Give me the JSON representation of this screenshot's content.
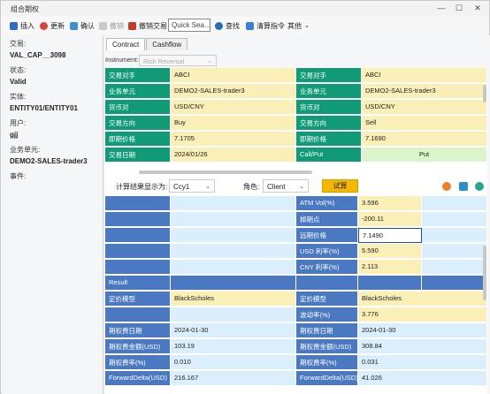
{
  "window": {
    "title": "组合期权",
    "min": "—",
    "max": "☐",
    "close": "✕"
  },
  "toolbar": {
    "insert": "插入",
    "update": "更新",
    "confirm": "确认",
    "cancel_deal": "撤销",
    "withdraw": "撤销交易",
    "search_placeholder": "Quick Sea...",
    "find": "查找",
    "clearing": "清算指令",
    "other": "其他"
  },
  "left": {
    "trade_no_label": "交易:",
    "trade_no": "VAL_CAP__3098",
    "status_label": "状态:",
    "status": "Valid",
    "entity_label": "实体:",
    "entity": "ENTITY01/ENTITY01",
    "user_label": "用户:",
    "user": "gjj",
    "bu_label": "业务单元:",
    "bu": "DEMO2-SALES-trader3",
    "event_label": "事件:"
  },
  "tabs": {
    "contract": "Contract",
    "cashflow": "Cashflow"
  },
  "instrument": {
    "label": "Instrument:",
    "value": "Risk Reversal"
  },
  "legs": {
    "rows": [
      {
        "l1": "交易对手",
        "v1": "ABCI",
        "l2": "交易对手",
        "v2": "ABCI"
      },
      {
        "l1": "业务单元",
        "v1": "DEMO2-SALES-trader3",
        "l2": "业务单元",
        "v2": "DEMO2-SALES-trader3"
      },
      {
        "l1": "货币对",
        "v1": "USD/CNY",
        "l2": "货币对",
        "v2": "USD/CNY"
      },
      {
        "l1": "交易方向",
        "v1": "Buy",
        "l2": "交易方向",
        "v2": "Sell"
      },
      {
        "l1": "即期价格",
        "v1": "7.1705",
        "l2": "即期价格",
        "v2": "7.1690"
      },
      {
        "l1": "交易日期",
        "v1": "2024/01/26",
        "l2": "Call/Put",
        "v2": "Put"
      }
    ]
  },
  "calc": {
    "display_label": "计算结果显示为:",
    "display_value": "Ccy1",
    "role_label": "角色:",
    "role_value": "Client",
    "trial_button": "试算"
  },
  "result": {
    "upper_rows": [
      {
        "l2": "ATM Vol(%)",
        "v2": "3.596"
      },
      {
        "l2": "掉期点",
        "v2": "-200.11"
      },
      {
        "l2": "远期价格",
        "v2": "7.1490"
      },
      {
        "l2": "USD 利率(%)",
        "v2": "5.590"
      },
      {
        "l2": "CNY 利率(%)",
        "v2": "2.113"
      }
    ],
    "section_label": "Result",
    "lower_rows": [
      {
        "l1": "定价模型",
        "v1": "BlackScholes",
        "l2": "定价模型",
        "v2": "BlackScholes"
      },
      {
        "l1": "",
        "v1": "",
        "l2": "波动率(%)",
        "v2": "3.776"
      },
      {
        "l1": "期权费日期",
        "v1": "2024-01-30",
        "l2": "期权费日期",
        "v2": "2024-01-30"
      },
      {
        "l1": "期权费金额(USD)",
        "v1": "103.19",
        "l2": "期权费金额(USD)",
        "v2": "308.84"
      },
      {
        "l1": "期权费率(%)",
        "v1": "0.010",
        "l2": "期权费率(%)",
        "v2": "0.031"
      },
      {
        "l1": "ForwardDelta(USD)",
        "v1": "216.167",
        "l2": "ForwardDelta(USD)",
        "v2": "41.026"
      }
    ]
  },
  "colors": {
    "green": "#109a76",
    "yellow": "#fbefb8",
    "blue": "#4a79c1",
    "light_blue": "#dbeefb",
    "trial": "#f5b800"
  }
}
